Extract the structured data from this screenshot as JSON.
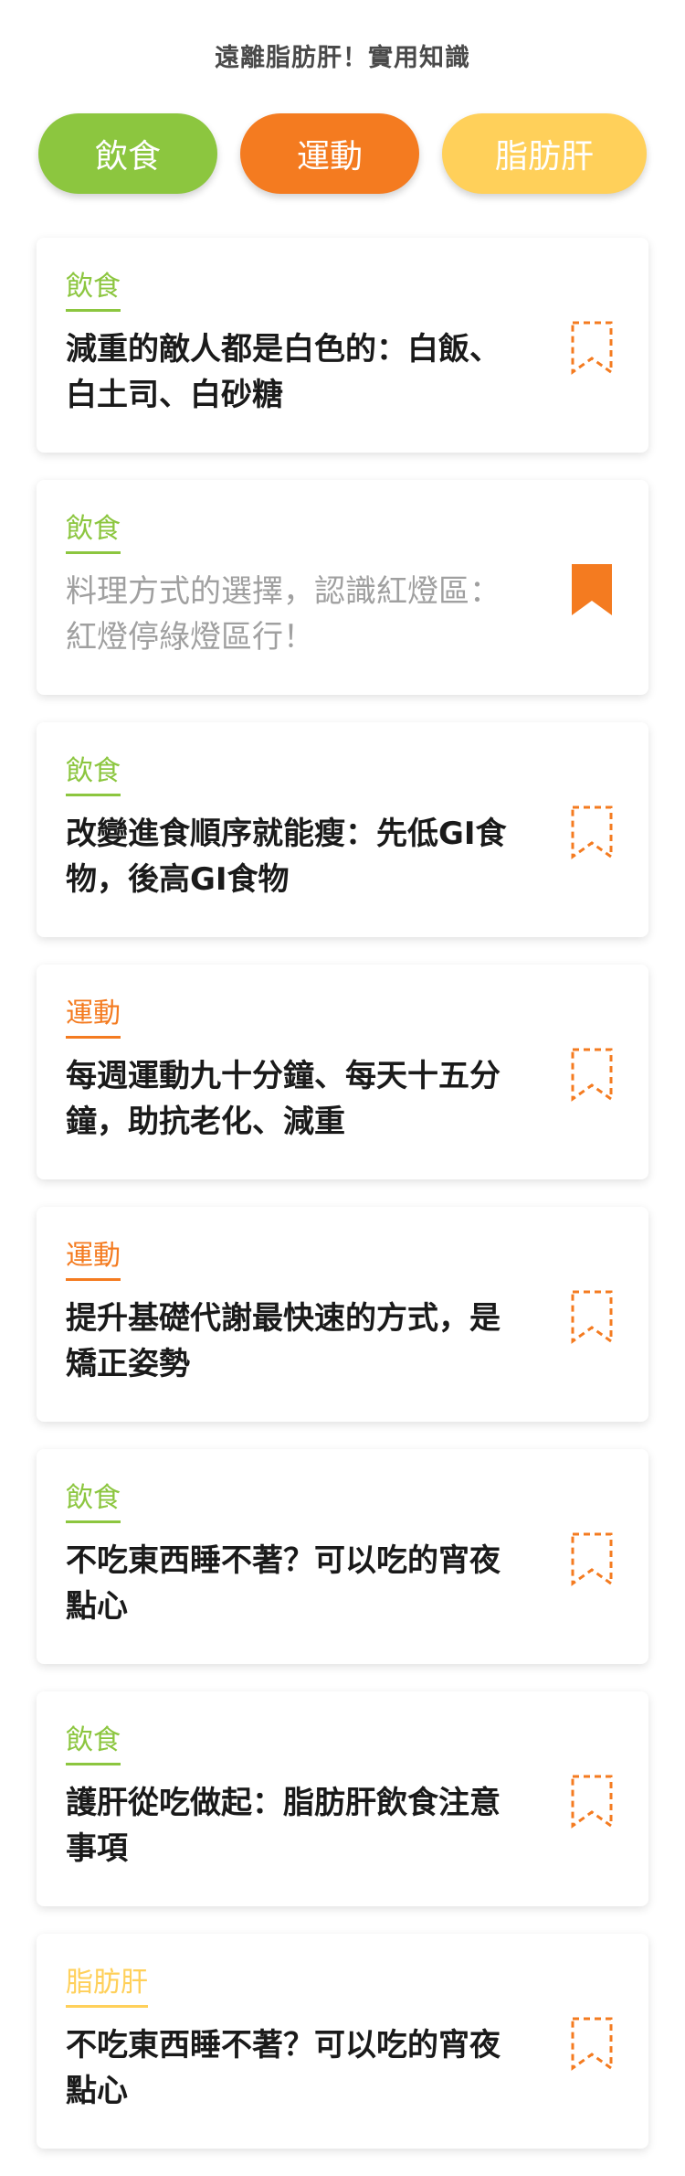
{
  "header": {
    "title": "遠離脂肪肝！實用知識"
  },
  "filters": [
    {
      "label": "飲食",
      "key": "food"
    },
    {
      "label": "運動",
      "key": "sport"
    },
    {
      "label": "脂肪肝",
      "key": "liver"
    }
  ],
  "colors": {
    "food": "#8cc63f",
    "sport": "#f47b20",
    "liver": "#ffd05a",
    "bookmark": "#f47b20"
  },
  "icons": {
    "bookmark_empty": "bookmark-outline-icon",
    "bookmark_filled": "bookmark-filled-icon"
  },
  "articles": [
    {
      "category": "飲食",
      "category_key": "food",
      "title": "減重的敵人都是白色的：白飯、白土司、白砂糖",
      "bookmarked": false,
      "read": false
    },
    {
      "category": "飲食",
      "category_key": "food",
      "title": "料理方式的選擇，認識紅燈區：紅燈停綠燈區行！",
      "bookmarked": true,
      "read": true
    },
    {
      "category": "飲食",
      "category_key": "food",
      "title": "改變進食順序就能瘦：先低GI食物，後高GI食物",
      "bookmarked": false,
      "read": false
    },
    {
      "category": "運動",
      "category_key": "sport",
      "title": "每週運動九十分鐘、每天十五分鐘，助抗老化、減重",
      "bookmarked": false,
      "read": false
    },
    {
      "category": "運動",
      "category_key": "sport",
      "title": "提升基礎代謝最快速的方式，是矯正姿勢",
      "bookmarked": false,
      "read": false
    },
    {
      "category": "飲食",
      "category_key": "food",
      "title": "不吃東西睡不著？可以吃的宵夜點心",
      "bookmarked": false,
      "read": false
    },
    {
      "category": "飲食",
      "category_key": "food",
      "title": "護肝從吃做起：脂肪肝飲食注意事項",
      "bookmarked": false,
      "read": false
    },
    {
      "category": "脂肪肝",
      "category_key": "liver",
      "title": "不吃東西睡不著？可以吃的宵夜點心",
      "bookmarked": false,
      "read": false
    }
  ]
}
